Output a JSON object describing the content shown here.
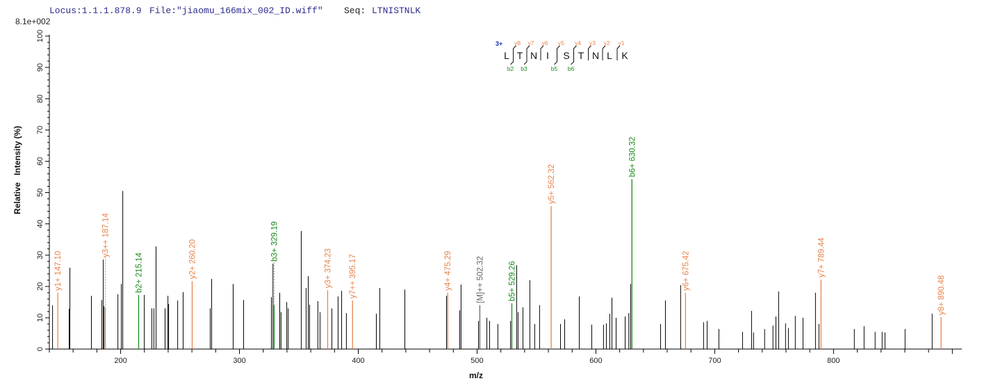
{
  "header": {
    "locus_label": "Locus:1.1.1.878.9",
    "file_label": "File:\"jiaomu_166mix_002_ID.wiff\"",
    "seq_key": "Seq:",
    "seq_value": "LTNISTNLK",
    "max_intensity": "8.1e+002"
  },
  "fragment_map": {
    "charge": "3+",
    "residues": [
      "L",
      "T",
      "N",
      "I",
      "S",
      "T",
      "N",
      "L",
      "K"
    ],
    "y_ions": [
      "y8",
      "y7",
      "y6",
      "y5",
      "y4",
      "y3",
      "y2",
      "y1"
    ],
    "b_ions": [
      {
        "label": "b2",
        "after": 1
      },
      {
        "label": "b3",
        "after": 2
      },
      {
        "label": "b5",
        "after": 4
      },
      {
        "label": "b6",
        "after": 5
      }
    ]
  },
  "colors": {
    "y_ion": "#e8834a",
    "b_ion": "#1a8a1a",
    "precursor": "#666666",
    "unassigned": "#000000",
    "header": "#2b2b8c",
    "charge": "#1a2fb0"
  },
  "chart_data": {
    "type": "bar",
    "title": "",
    "xlabel": "m/z",
    "ylabel": "Relative   Intensity (%)",
    "xlim": [
      140,
      908
    ],
    "ylim": [
      0,
      100
    ],
    "x_ticks": [
      200,
      300,
      400,
      500,
      600,
      700,
      800
    ],
    "y_ticks": [
      0,
      10,
      20,
      30,
      40,
      50,
      60,
      70,
      80,
      90,
      100
    ],
    "grid": false,
    "peaks": [
      {
        "mz": 142.7,
        "i": 14
      },
      {
        "mz": 147.1,
        "i": 18,
        "type": "y",
        "label": "y1+ 147.10"
      },
      {
        "mz": 156.7,
        "i": 12.9
      },
      {
        "mz": 157.3,
        "i": 26
      },
      {
        "mz": 175.4,
        "i": 17
      },
      {
        "mz": 184.2,
        "i": 15.7
      },
      {
        "mz": 185.4,
        "i": 28.6
      },
      {
        "mz": 186.0,
        "i": 13.7
      },
      {
        "mz": 187.14,
        "i": 13,
        "type": "y",
        "label": "y3++ 187.14"
      },
      {
        "mz": 197.7,
        "i": 17.5
      },
      {
        "mz": 200.6,
        "i": 20.8
      },
      {
        "mz": 201.8,
        "i": 50.5
      },
      {
        "mz": 215.14,
        "i": 17.3,
        "type": "b",
        "label": "b2+ 215.14"
      },
      {
        "mz": 219.9,
        "i": 17.3
      },
      {
        "mz": 226.3,
        "i": 13
      },
      {
        "mz": 228.0,
        "i": 13
      },
      {
        "mz": 229.8,
        "i": 32.8
      },
      {
        "mz": 237.4,
        "i": 13
      },
      {
        "mz": 239.8,
        "i": 17
      },
      {
        "mz": 240.4,
        "i": 14.4
      },
      {
        "mz": 248.0,
        "i": 15.5
      },
      {
        "mz": 252.6,
        "i": 18.2
      },
      {
        "mz": 260.2,
        "i": 21.7,
        "type": "y",
        "label": "y2+ 260.20"
      },
      {
        "mz": 275.4,
        "i": 13
      },
      {
        "mz": 276.6,
        "i": 22.4
      },
      {
        "mz": 294.7,
        "i": 20.8
      },
      {
        "mz": 303.5,
        "i": 15.7
      },
      {
        "mz": 326.9,
        "i": 16.6
      },
      {
        "mz": 328.2,
        "i": 27.3
      },
      {
        "mz": 329.19,
        "i": 14,
        "type": "b",
        "label": "b3+ 329.19"
      },
      {
        "mz": 333.9,
        "i": 18
      },
      {
        "mz": 335.0,
        "i": 11.8
      },
      {
        "mz": 339.8,
        "i": 15
      },
      {
        "mz": 341.0,
        "i": 13
      },
      {
        "mz": 352.0,
        "i": 37.7
      },
      {
        "mz": 356.1,
        "i": 19.5
      },
      {
        "mz": 357.9,
        "i": 23.3
      },
      {
        "mz": 359.0,
        "i": 14.2
      },
      {
        "mz": 366.0,
        "i": 15.3
      },
      {
        "mz": 367.8,
        "i": 11.8
      },
      {
        "mz": 374.23,
        "i": 18.8,
        "type": "y",
        "label": "y3+ 374.23"
      },
      {
        "mz": 377.8,
        "i": 13
      },
      {
        "mz": 383.0,
        "i": 16.8
      },
      {
        "mz": 386.0,
        "i": 18.6
      },
      {
        "mz": 390.0,
        "i": 11.5
      },
      {
        "mz": 395.17,
        "i": 15.5,
        "type": "y",
        "label": "y7++ 395.17"
      },
      {
        "mz": 415.2,
        "i": 11.3
      },
      {
        "mz": 418.1,
        "i": 19.5
      },
      {
        "mz": 439.2,
        "i": 19
      },
      {
        "mz": 474.3,
        "i": 17
      },
      {
        "mz": 475.29,
        "i": 18,
        "type": "y",
        "label": "y4+ 475.29"
      },
      {
        "mz": 485.4,
        "i": 12.4
      },
      {
        "mz": 486.5,
        "i": 20.6
      },
      {
        "mz": 501.2,
        "i": 9
      },
      {
        "mz": 502.32,
        "i": 14,
        "type": "m",
        "label": "[M]++ 502.32"
      },
      {
        "mz": 508.2,
        "i": 10
      },
      {
        "mz": 510.5,
        "i": 9
      },
      {
        "mz": 517.5,
        "i": 8
      },
      {
        "mz": 528.2,
        "i": 9
      },
      {
        "mz": 529.26,
        "i": 14.6,
        "type": "b",
        "label": "b5+ 529.26"
      },
      {
        "mz": 533.3,
        "i": 26.8
      },
      {
        "mz": 534.5,
        "i": 11.8
      },
      {
        "mz": 538.6,
        "i": 13.3
      },
      {
        "mz": 544.4,
        "i": 22
      },
      {
        "mz": 548.5,
        "i": 8
      },
      {
        "mz": 552.6,
        "i": 14
      },
      {
        "mz": 562.32,
        "i": 45.7,
        "type": "y",
        "label": "y5+ 562.32"
      },
      {
        "mz": 570.2,
        "i": 8
      },
      {
        "mz": 573.7,
        "i": 9.5
      },
      {
        "mz": 586.0,
        "i": 16.8
      },
      {
        "mz": 596.5,
        "i": 7.8
      },
      {
        "mz": 606.4,
        "i": 7.8
      },
      {
        "mz": 608.8,
        "i": 8.2
      },
      {
        "mz": 611.7,
        "i": 11.3
      },
      {
        "mz": 613.5,
        "i": 16.4
      },
      {
        "mz": 617.0,
        "i": 10
      },
      {
        "mz": 624.6,
        "i": 10.4
      },
      {
        "mz": 627.7,
        "i": 11.5
      },
      {
        "mz": 629.2,
        "i": 20.8
      },
      {
        "mz": 630.32,
        "i": 54.3,
        "type": "b",
        "label": "b6+ 630.32"
      },
      {
        "mz": 654.4,
        "i": 8
      },
      {
        "mz": 658.5,
        "i": 15.5
      },
      {
        "mz": 671.3,
        "i": 20.4
      },
      {
        "mz": 675.42,
        "i": 18,
        "type": "y",
        "label": "y6+ 675.42"
      },
      {
        "mz": 690.6,
        "i": 8.6
      },
      {
        "mz": 693.6,
        "i": 9
      },
      {
        "mz": 703.5,
        "i": 6.4
      },
      {
        "mz": 723.4,
        "i": 5.5
      },
      {
        "mz": 731.0,
        "i": 12.2
      },
      {
        "mz": 732.7,
        "i": 5.3
      },
      {
        "mz": 742.0,
        "i": 6.4
      },
      {
        "mz": 749.0,
        "i": 7.5
      },
      {
        "mz": 751.5,
        "i": 10.4
      },
      {
        "mz": 753.8,
        "i": 18.4
      },
      {
        "mz": 759.6,
        "i": 8.2
      },
      {
        "mz": 762.0,
        "i": 6.7
      },
      {
        "mz": 767.8,
        "i": 10.6
      },
      {
        "mz": 774.3,
        "i": 10
      },
      {
        "mz": 784.8,
        "i": 18
      },
      {
        "mz": 787.7,
        "i": 8
      },
      {
        "mz": 789.44,
        "i": 22.2,
        "type": "y",
        "label": "y7+ 789.44"
      },
      {
        "mz": 817.5,
        "i": 6.4
      },
      {
        "mz": 825.7,
        "i": 7.3
      },
      {
        "mz": 835.0,
        "i": 5.5
      },
      {
        "mz": 840.9,
        "i": 5.5
      },
      {
        "mz": 843.3,
        "i": 5.3
      },
      {
        "mz": 860.2,
        "i": 6.4
      },
      {
        "mz": 883.0,
        "i": 11.3
      },
      {
        "mz": 890.48,
        "i": 10.2,
        "type": "y",
        "label": "y8+ 890.48"
      }
    ]
  }
}
